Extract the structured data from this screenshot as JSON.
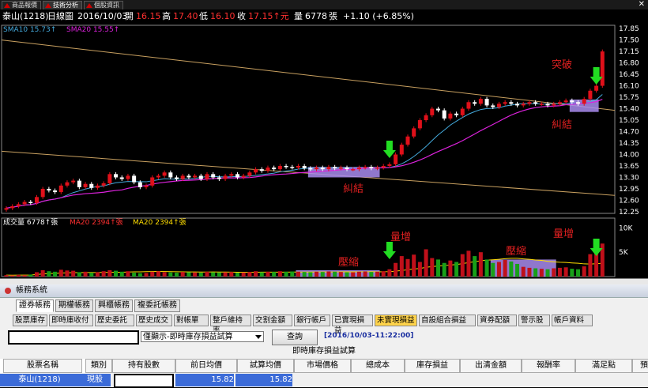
{
  "top_tabs": [
    "商品報價",
    "技術分析",
    "個股資訊"
  ],
  "info": {
    "symbol": "泰山(1218)",
    "period": "日線圖",
    "date": "2016/10/03",
    "open_label": "開",
    "open": "16.15",
    "high_label": "高",
    "high": "17.40",
    "low_label": "低",
    "low": "16.10",
    "close_label": "收",
    "close": "17.15↑元",
    "volume_label": "量",
    "volume": "6778",
    "volume_unit": "張",
    "change": "+1.10 (+6.85%)"
  },
  "chart_data": {
    "type": "candlestick",
    "price_axis": [
      "17.85",
      "17.50",
      "17.15",
      "16.80",
      "16.45",
      "16.10",
      "15.75",
      "15.40",
      "15.05",
      "14.70",
      "14.35",
      "14.00",
      "13.65",
      "13.30",
      "12.95",
      "12.60",
      "12.25"
    ],
    "volume_axis": [
      "10K",
      "5K"
    ],
    "legend_price": {
      "sma10": "SMA10 15.73↑",
      "sma20": "SMA20 15.55↑"
    },
    "legend_volume": {
      "vol": "成交量 6778↑張",
      "ma20": "MA20 2394↑張",
      "ma20b": "MA20 2394↑張"
    },
    "annotations": {
      "breakout": "突破",
      "tangle1": "糾結",
      "tangle2": "糾結",
      "shrink1": "壓縮",
      "shrink2": "壓縮",
      "vol_up1": "量增",
      "vol_up2": "量增"
    },
    "colors": {
      "up": "#e0101a",
      "down": "#ffffff",
      "sma10": "#44aadd",
      "sma20": "#dd22dd",
      "ma_vol": "#ffdd00",
      "highlight": "#a98cf0",
      "trend": "#c8a060",
      "arrow": "#22dd22"
    },
    "closes": [
      12.36,
      12.42,
      12.48,
      12.55,
      12.52,
      12.7,
      12.95,
      12.9,
      12.85,
      13.05,
      13.15,
      13.2,
      13.0,
      13.1,
      12.98,
      13.05,
      13.12,
      13.4,
      13.3,
      13.25,
      13.35,
      13.15,
      13.0,
      13.05,
      13.3,
      13.35,
      13.45,
      13.3,
      13.25,
      13.35,
      13.3,
      13.35,
      13.25,
      13.4,
      13.3,
      13.25,
      13.35,
      13.4,
      13.3,
      13.35,
      13.45,
      13.55,
      13.5,
      13.6,
      13.55,
      13.65,
      13.62,
      13.6,
      13.65,
      13.58,
      13.55,
      13.6,
      13.55,
      13.62,
      13.58,
      13.6,
      13.55,
      13.55,
      13.6,
      13.62,
      13.58,
      13.6,
      13.65,
      13.7,
      14.0,
      14.3,
      14.55,
      14.8,
      15.05,
      15.2,
      15.4,
      15.35,
      15.1,
      15.25,
      15.2,
      15.4,
      15.6,
      15.55,
      15.7,
      15.5,
      15.45,
      15.55,
      15.6,
      15.55,
      15.5,
      15.55,
      15.6,
      15.55,
      15.55,
      15.5,
      15.55,
      15.6,
      15.65,
      15.6,
      15.55,
      15.7,
      15.95,
      16.1,
      17.15
    ],
    "volumes": [
      300,
      250,
      350,
      280,
      420,
      900,
      1300,
      1100,
      1000,
      1400,
      1250,
      1200,
      900,
      1000,
      800,
      900,
      1100,
      1300,
      1200,
      1000,
      1100,
      800,
      700,
      750,
      1000,
      1100,
      900,
      850,
      800,
      950,
      900,
      850,
      800,
      1000,
      900,
      850,
      900,
      950,
      800,
      850,
      950,
      1100,
      900,
      1000,
      950,
      1100,
      1000,
      1050,
      1000,
      950,
      900,
      1000,
      950,
      1050,
      1000,
      950,
      900,
      900,
      1000,
      1050,
      950,
      1000,
      1100,
      1500,
      2800,
      4200,
      3600,
      4500,
      3000,
      5600,
      3800,
      3500,
      2800,
      3300,
      3000,
      4600,
      5300,
      4200,
      5000,
      3500,
      2800,
      3000,
      3400,
      3100,
      2600,
      2000,
      1800,
      1700,
      1600,
      1500,
      1700,
      1800,
      1900,
      1600,
      1500,
      2100,
      4600,
      5600,
      6778
    ]
  },
  "panel": {
    "title": "帳務系統",
    "tabs1": [
      "證券帳務",
      "期權帳務",
      "興櫃帳務",
      "複委託帳務"
    ],
    "tabs2": [
      "股票庫存",
      "即時庫收付",
      "歷史委託",
      "歷史成交",
      "對帳單",
      "整戶維持率",
      "交割金額",
      "銀行帳戶",
      "已實現損益",
      "未實現損益",
      "自設組合損益",
      "資券配額",
      "警示股",
      "帳戶資料"
    ],
    "select_value": "僅顯示-即時庫存損益試算",
    "query_button": "查詢",
    "timestamp": "[2016/10/03-11:22:00]",
    "subtitle": "即時庫存損益試算",
    "headers": [
      "股票名稱",
      "類別",
      "持有股數",
      "前日均價",
      "試算均價",
      "市場價格",
      "總成本",
      "庫存損益",
      "出清金額",
      "報酬率",
      "滿足點",
      "預估"
    ],
    "row": {
      "name": "泰山(1218)",
      "type": "現股",
      "shares": "",
      "prev_avg": "15.82",
      "calc_avg": "15.82"
    }
  }
}
